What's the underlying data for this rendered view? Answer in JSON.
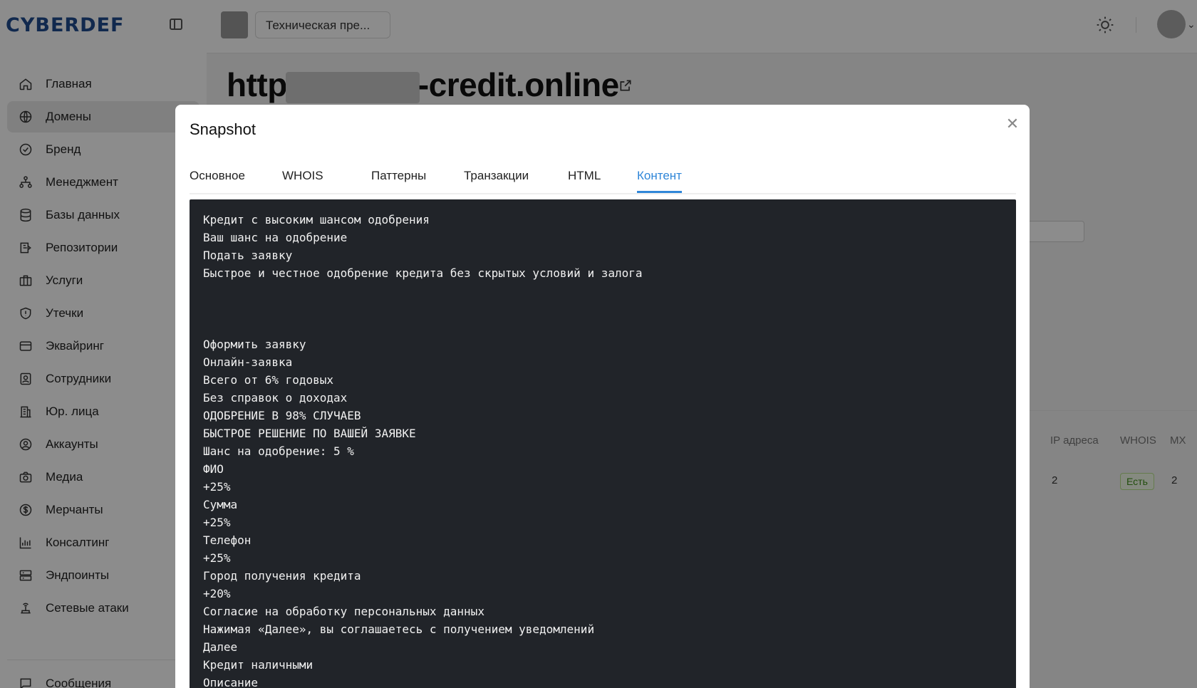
{
  "header": {
    "logo": "CYBERDEF",
    "project_name": "Техническая пре..."
  },
  "sidebar": {
    "items": [
      {
        "label": "Главная",
        "icon": "home-icon",
        "active": false
      },
      {
        "label": "Домены",
        "icon": "globe-icon",
        "active": true
      },
      {
        "label": "Бренд",
        "icon": "badge-check-icon",
        "active": false
      },
      {
        "label": "Менеджмент",
        "icon": "org-chart-icon",
        "active": false
      },
      {
        "label": "Базы данных",
        "icon": "database-icon",
        "active": false
      },
      {
        "label": "Репозитории",
        "icon": "repository-icon",
        "active": false
      },
      {
        "label": "Услуги",
        "icon": "briefcase-icon",
        "active": false
      },
      {
        "label": "Утечки",
        "icon": "shield-icon",
        "active": false
      },
      {
        "label": "Эквайринг",
        "icon": "credit-card-icon",
        "active": false
      },
      {
        "label": "Сотрудники",
        "icon": "id-card-icon",
        "active": false
      },
      {
        "label": "Юр. лица",
        "icon": "building-icon",
        "active": false
      },
      {
        "label": "Аккаунты",
        "icon": "user-circle-icon",
        "active": false
      },
      {
        "label": "Медиа",
        "icon": "camera-icon",
        "active": false
      },
      {
        "label": "Мерчанты",
        "icon": "dollar-icon",
        "active": false
      },
      {
        "label": "Консалтинг",
        "icon": "chart-icon",
        "active": false
      },
      {
        "label": "Эндпоинты",
        "icon": "server-icon",
        "active": false
      },
      {
        "label": "Сетевые атаки",
        "icon": "network-icon",
        "active": false
      },
      {
        "label": "Сообщения",
        "icon": "message-icon",
        "active": false
      }
    ]
  },
  "page": {
    "title_prefix": "http",
    "title_suffix": "-credit.online",
    "table": {
      "headers": [
        "IP адреса",
        "WHOIS",
        "MX"
      ],
      "row": {
        "ip_count": "2",
        "whois": "Есть",
        "mx": "2"
      }
    }
  },
  "modal": {
    "title": "Snapshot",
    "tabs": [
      {
        "label": "Основное",
        "active": false
      },
      {
        "label": "WHOIS",
        "active": false
      },
      {
        "label": "Паттерны",
        "active": false
      },
      {
        "label": "Транзакции",
        "active": false
      },
      {
        "label": "HTML",
        "active": false
      },
      {
        "label": "Контент",
        "active": true
      }
    ],
    "content_lines": [
      "Кредит с высоким шансом одобрения",
      "Ваш шанс на одобрение",
      "Подать заявку",
      "Быстрое и честное одобрение кредита без скрытых условий и залога",
      "",
      "",
      "",
      "Оформить заявку",
      "Онлайн-заявка",
      "Всего от 6% годовых",
      "Без справок о доходах",
      "ОДОБРЕНИЕ В 98% СЛУЧАЕВ",
      "БЫСТРОЕ РЕШЕНИЕ ПО ВАШЕЙ ЗАЯВКЕ",
      "Шанс на одобрение: 5 %",
      "ФИО",
      "+25%",
      "Сумма",
      "+25%",
      "Телефон",
      "+25%",
      "Город получения кредита",
      "+20%",
      "Согласие на обработку персональных данных",
      "Нажимая «Далее», вы соглашаетесь с получением уведомлений",
      "Далее",
      "Кредит наличными",
      "Описание"
    ]
  },
  "colors": {
    "accent": "#2f86d8",
    "logo": "#1f4b8f",
    "content_bg": "#212429",
    "badge_green": "#3f8f1a"
  }
}
